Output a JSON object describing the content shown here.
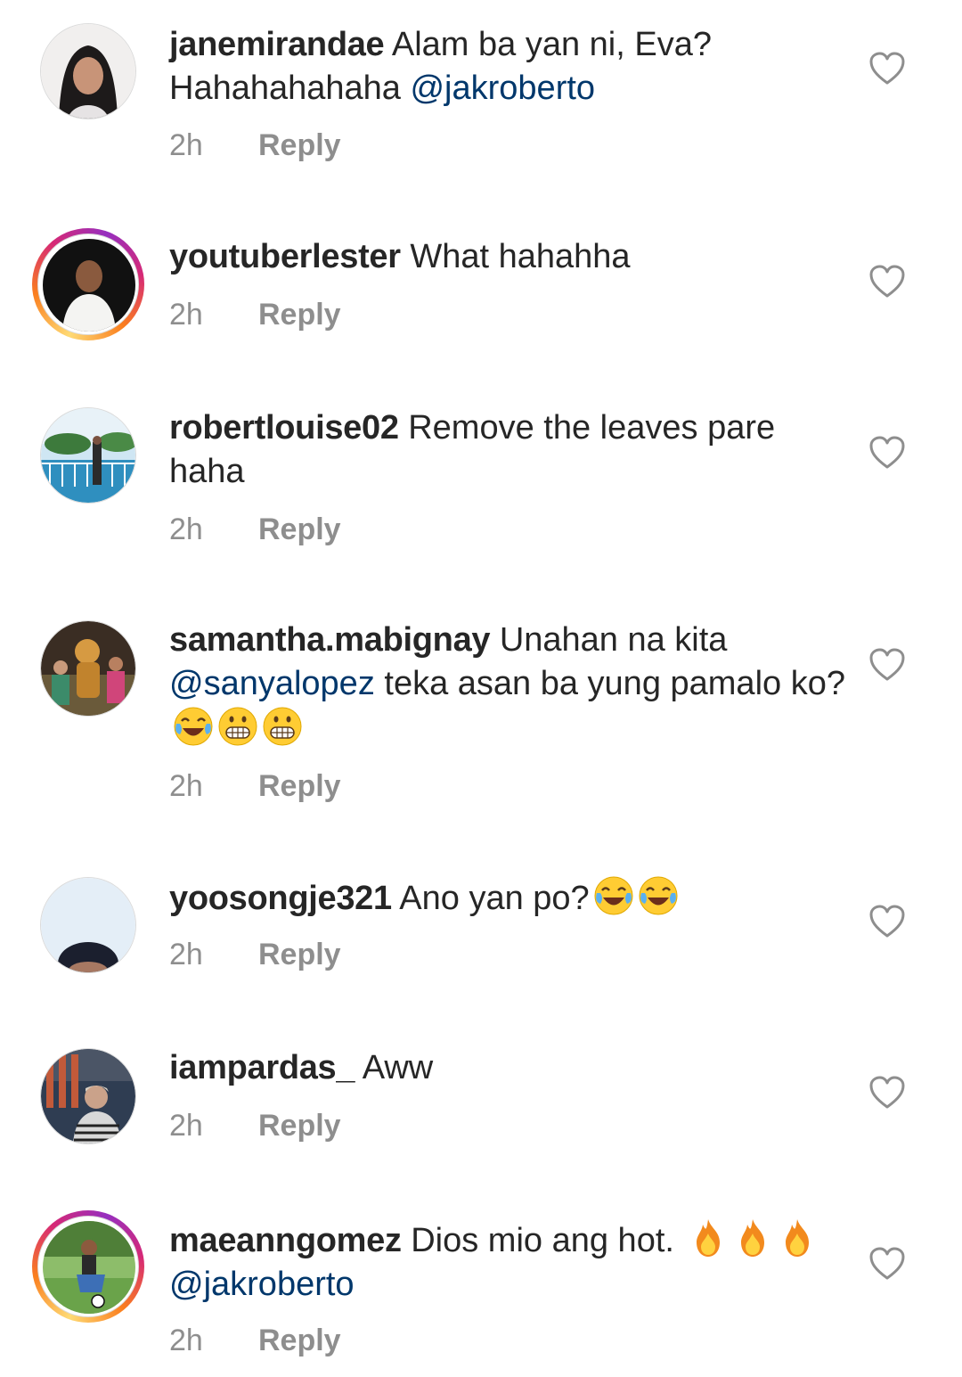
{
  "comments": [
    {
      "username": "janemirandae",
      "pre": "Alam ba yan ni,  Eva? Hahahahahaha ",
      "mention": "@jakroberto",
      "post": "",
      "time": "2h",
      "reply": "Reply"
    },
    {
      "username": "youtuberlester",
      "pre": "What hahahha",
      "time": "2h",
      "reply": "Reply"
    },
    {
      "username": "robertlouise02",
      "pre": "Remove the leaves pare haha",
      "time": "2h",
      "reply": "Reply"
    },
    {
      "username": "samantha.mabignay",
      "pre": "Unahan na kita ",
      "mention": "@sanyalopez",
      "post": " teka  asan ba yung pamalo ko?",
      "emojis": [
        "face-with-tears-of-joy",
        "grimacing-face",
        "grimacing-face"
      ],
      "time": "2h",
      "reply": "Reply"
    },
    {
      "username": "yoosongje321",
      "pre": "Ano yan po?",
      "emojis": [
        "face-with-tears-of-joy",
        "face-with-tears-of-joy"
      ],
      "time": "2h",
      "reply": "Reply"
    },
    {
      "username": "iampardas_",
      "pre": "Aww",
      "time": "2h",
      "reply": "Reply"
    },
    {
      "username": "maeanngomez",
      "pre": "Dios mio ang hot. ",
      "emojis": [
        "fire",
        "fire",
        "fire"
      ],
      "mention": "@jakroberto",
      "time": "2h",
      "reply": "Reply"
    }
  ],
  "colors": {
    "text": "#262626",
    "secondary": "#8e8e8e",
    "mention": "#00376b",
    "story_ring": "#d62976"
  }
}
